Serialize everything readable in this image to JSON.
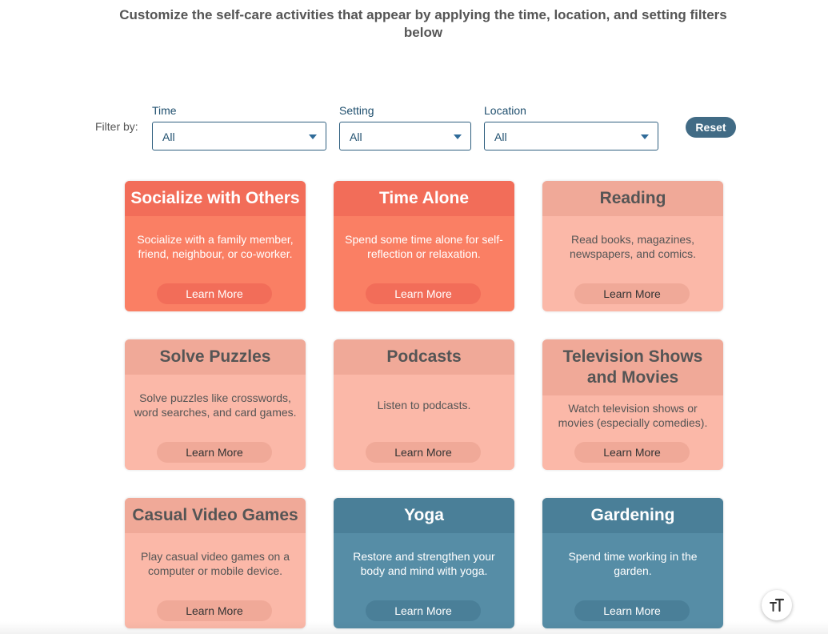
{
  "intro": "Customize the self-care activities that appear by applying the time, location, and setting filters below",
  "filters": {
    "filter_by_label": "Filter by:",
    "time": {
      "label": "Time",
      "value": "All"
    },
    "setting": {
      "label": "Setting",
      "value": "All"
    },
    "location": {
      "label": "Location",
      "value": "All"
    },
    "reset_label": "Reset"
  },
  "cards": [
    {
      "title": "Socialize with Others",
      "description": "Socialize with a family member, friend, neighbour, or co-worker.",
      "button": "Learn More",
      "theme": "#fa7f64"
    },
    {
      "title": "Time Alone",
      "description": "Spend some time alone for self-reflection or relaxation.",
      "button": "Learn More",
      "theme": "#fa7f64"
    },
    {
      "title": "Reading",
      "description": "Read books, magazines, newspapers, and comics.",
      "button": "Learn More",
      "theme": "#fbb8a8"
    },
    {
      "title": "Solve Puzzles",
      "description": "Solve puzzles like crosswords, word searches, and card games.",
      "button": "Learn More",
      "theme": "#fbb8a8"
    },
    {
      "title": "Podcasts",
      "description": "Listen to podcasts.",
      "button": "Learn More",
      "theme": "#fbb8a8"
    },
    {
      "title": "Television Shows and Movies",
      "description": "Watch television shows or movies (especially comedies).",
      "button": "Learn More",
      "theme": "#fbb8a8"
    },
    {
      "title": "Casual Video Games",
      "description": "Play casual video games on a computer or mobile device.",
      "button": "Learn More",
      "theme": "#fbb8a8"
    },
    {
      "title": "Yoga",
      "description": "Restore and strengthen your body and mind with yoga.",
      "button": "Learn More",
      "theme": "#568da6"
    },
    {
      "title": "Gardening",
      "description": "Spend time working in the garden.",
      "button": "Learn More",
      "theme": "#568da6"
    }
  ],
  "colors": {
    "accent_strong": "#f26d59",
    "accent_soft": "#f0a998",
    "accent_teal": "#4a7f98",
    "reset_button": "#416b85",
    "select_text": "#1f4f6e"
  },
  "font_size_button": {
    "icon": "text-size-icon"
  }
}
